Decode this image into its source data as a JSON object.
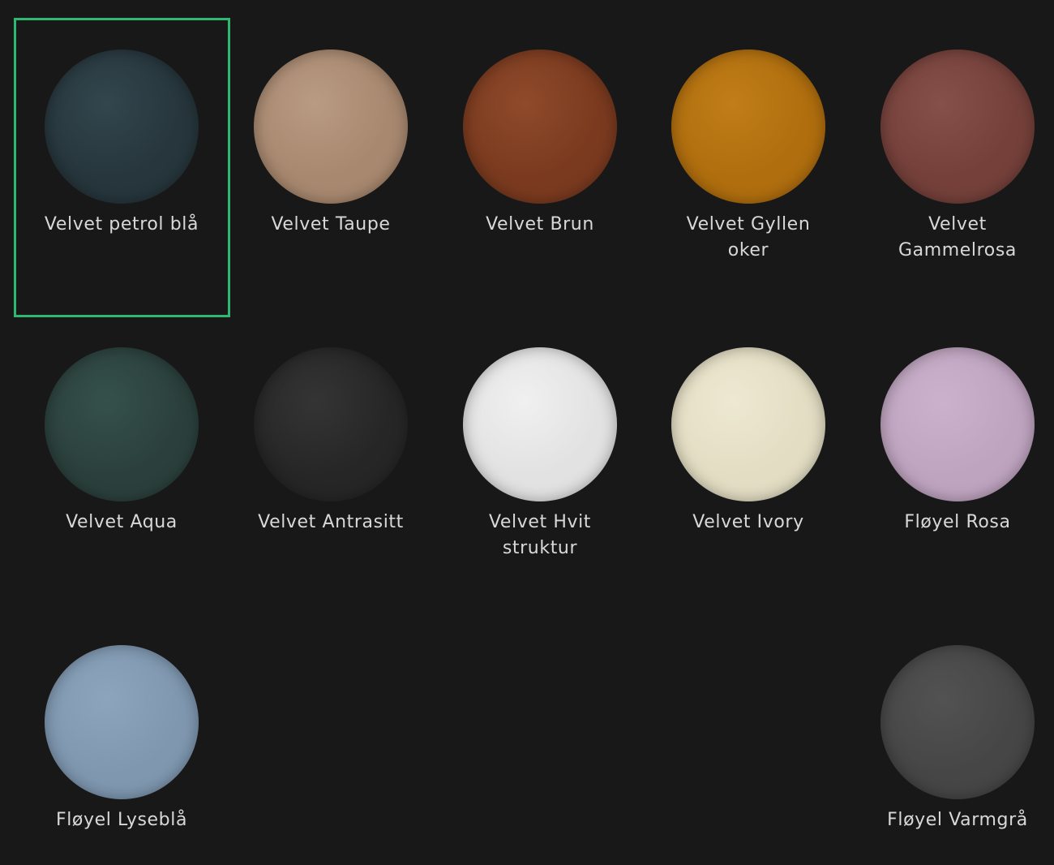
{
  "selected_index": 0,
  "swatches": [
    {
      "label": "Velvet petrol blå",
      "color": "#26363c",
      "highlight": "#33464d"
    },
    {
      "label": "Velvet Taupe",
      "color": "#a8886f",
      "highlight": "#b99a82"
    },
    {
      "label": "Velvet Brun",
      "color": "#7a3a1f",
      "highlight": "#8f4a2a"
    },
    {
      "label": "Velvet Gyllen oker",
      "color": "#b06e0e",
      "highlight": "#c07d18"
    },
    {
      "label": "Velvet Gammelrosa",
      "color": "#75403a",
      "highlight": "#86504a"
    },
    {
      "label": "Velvet Aqua",
      "color": "#2b403c",
      "highlight": "#35504a"
    },
    {
      "label": "Velvet Antrasitt",
      "color": "#272626",
      "highlight": "#353434"
    },
    {
      "label": "Velvet Hvit struktur",
      "color": "#e2e2e2",
      "highlight": "#f0f0f0"
    },
    {
      "label": "Velvet Ivory",
      "color": "#e3ddc3",
      "highlight": "#ede8d2"
    },
    {
      "label": "Fløyel Rosa",
      "color": "#bfa4c0",
      "highlight": "#cbb2cc"
    },
    {
      "label": "Fløyel Lyseblå",
      "color": "#7f98b0",
      "highlight": "#8ca5bc"
    },
    {
      "label": "Fløyel Varmgrå",
      "color": "#464647",
      "highlight": "#525253"
    }
  ]
}
